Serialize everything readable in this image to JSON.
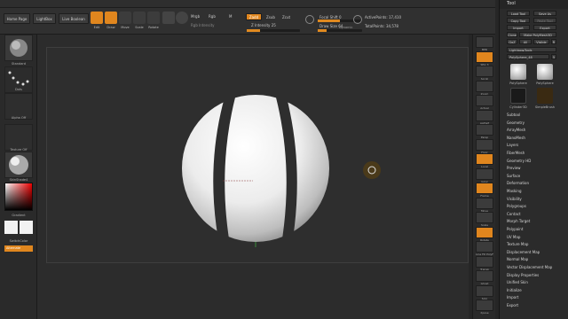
{
  "menubar": [
    "Alpha",
    "Brush",
    "Color",
    "Document",
    "Draw",
    "Edit",
    "File",
    "Layer",
    "Light",
    "Macro",
    "Marker",
    "Material",
    "Movie",
    "Picker",
    "Preferences",
    "Render",
    "Stencil",
    "Stroke",
    "Texture",
    "Tool",
    "Transform",
    "Zplugin",
    "Zscript"
  ],
  "toolbar": {
    "home_page": "Home Page",
    "lightbox": "LightBox",
    "live_boolean": "Live Boolean",
    "edit": "Edit",
    "draw": "Draw",
    "move": "Move",
    "scale": "Scale",
    "rotate": "Rotate",
    "mrgb": "Mrgb",
    "rgb": "Rgb",
    "m": "M",
    "zadd": "Zadd",
    "zsub": "Zsub",
    "zcut": "Zcut",
    "rgb_intensity": "Rgb Intensity",
    "z_intensity": "Z Intensity 25",
    "focal_shift": "Focal Shift 0",
    "draw_size": "Draw Size 64",
    "dynamic": "Dynamic",
    "active_points": "ActivePoints: 17,410",
    "total_points": "TotalPoints: 34,578"
  },
  "leftshelf": {
    "standard": "Standard",
    "dots": "Dots",
    "alpha_off": "Alpha Off",
    "texture_off": "Texture Off",
    "skinshade": "SkinShade4",
    "gradient": "Gradient",
    "switch_color": "SwitchColor",
    "alternate": "Alternate"
  },
  "rightshelf": [
    "BPR",
    "SPix 3",
    "Scroll",
    "Zoom",
    "Actual",
    "AAHalf",
    "Persp",
    "Floor",
    "Local",
    "Gxyz",
    "Frame",
    "Move",
    "Scale",
    "Rotate",
    "Line Fill PolyF",
    "Transp",
    "Ghost",
    "Solo",
    "Xpose"
  ],
  "palette": {
    "title": "Tool",
    "load_tool": "Load Tool",
    "save_as": "Save As",
    "copy_tool": "Copy Tool",
    "paste_tool": "Paste Tool",
    "import": "Import",
    "export": "Export",
    "clone": "Clone",
    "make_polymesh": "Make PolyMesh3D",
    "goz": "GoZ",
    "all": "All",
    "visible": "Visible",
    "r": "R",
    "lightbox_tools": "Lightbox▸Tools",
    "polysphere_slider": "PolySphere_48",
    "number": "5",
    "thumbs": [
      "PolySphere",
      "PolySphere",
      "Cylinder3D",
      "SimpleBrush"
    ],
    "subpalettes": [
      "Subtool",
      "Geometry",
      "ArrayMesh",
      "NanoMesh",
      "Layers",
      "FiberMesh",
      "Geometry HD",
      "Preview",
      "Surface",
      "Deformation",
      "Masking",
      "Visibility",
      "Polygroups",
      "Contact",
      "Morph Target",
      "Polypaint",
      "UV Map",
      "Texture Map",
      "Displacement Map",
      "Normal Map",
      "Vector Displacement Map",
      "Display Properties",
      "Unified Skin",
      "Initialize",
      "Import",
      "Export"
    ]
  },
  "colors": {
    "accent": "#e0861e",
    "background": "#262626",
    "panel": "#2b2b2b"
  }
}
